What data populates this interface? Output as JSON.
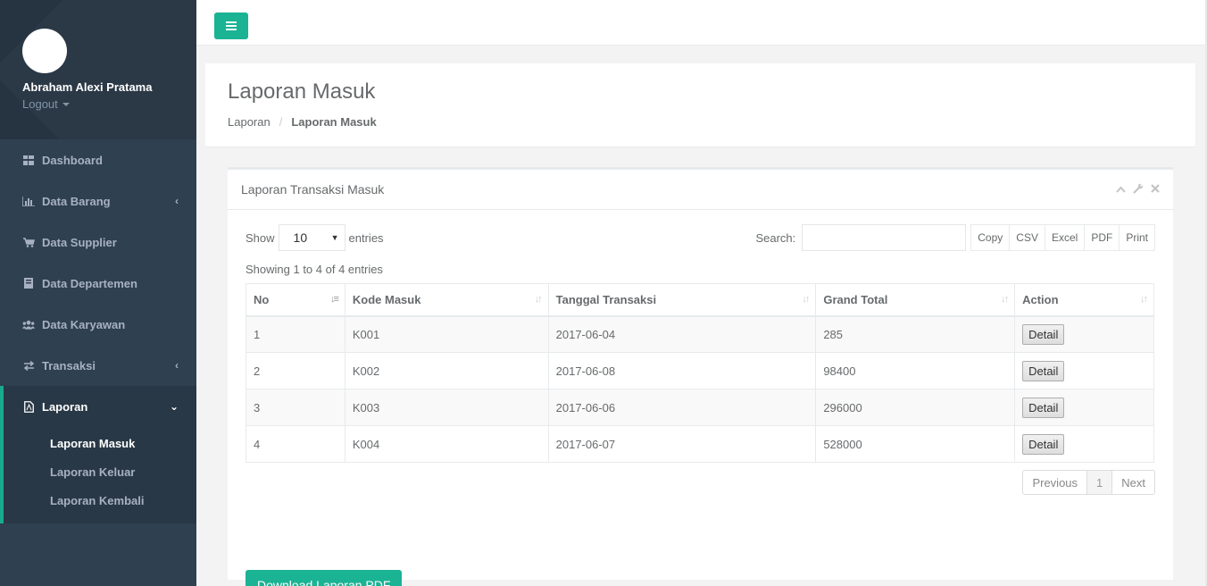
{
  "user": {
    "name": "Abraham Alexi Pratama",
    "logout": "Logout"
  },
  "sidebar": {
    "items": [
      {
        "label": "Dashboard",
        "icon": "dashboard-icon"
      },
      {
        "label": "Data Barang",
        "icon": "bar-chart-icon"
      },
      {
        "label": "Data Supplier",
        "icon": "cart-icon"
      },
      {
        "label": "Data Departemen",
        "icon": "book-icon"
      },
      {
        "label": "Data Karyawan",
        "icon": "users-icon"
      },
      {
        "label": "Transaksi",
        "icon": "exchange-icon"
      },
      {
        "label": "Laporan",
        "icon": "pdf-file-icon"
      }
    ],
    "subitems": [
      "Laporan Masuk",
      "Laporan Keluar",
      "Laporan Kembali"
    ]
  },
  "page": {
    "title": "Laporan Masuk",
    "breadcrumb": [
      "Laporan",
      "Laporan Masuk"
    ]
  },
  "panel": {
    "title": "Laporan Transaksi Masuk",
    "show_label": "Show",
    "entries_value": "10",
    "entries_label": "entries",
    "search_label": "Search:",
    "search_value": "",
    "export_buttons": [
      "Copy",
      "CSV",
      "Excel",
      "PDF",
      "Print"
    ],
    "info": "Showing 1 to 4 of 4 entries",
    "columns": [
      "No",
      "Kode Masuk",
      "Tanggal Transaksi",
      "Grand Total",
      "Action"
    ],
    "rows": [
      {
        "no": "1",
        "kode": "K001",
        "tanggal": "2017-06-04",
        "total": "285",
        "action": "Detail"
      },
      {
        "no": "2",
        "kode": "K002",
        "tanggal": "2017-06-08",
        "total": "98400",
        "action": "Detail"
      },
      {
        "no": "3",
        "kode": "K003",
        "tanggal": "2017-06-06",
        "total": "296000",
        "action": "Detail"
      },
      {
        "no": "4",
        "kode": "K004",
        "tanggal": "2017-06-07",
        "total": "528000",
        "action": "Detail"
      }
    ],
    "pagination": {
      "previous": "Previous",
      "current": "1",
      "next": "Next"
    },
    "download_label": "Download Laporan PDF"
  },
  "colors": {
    "accent": "#1ab394",
    "sidebar": "#2f4050"
  }
}
